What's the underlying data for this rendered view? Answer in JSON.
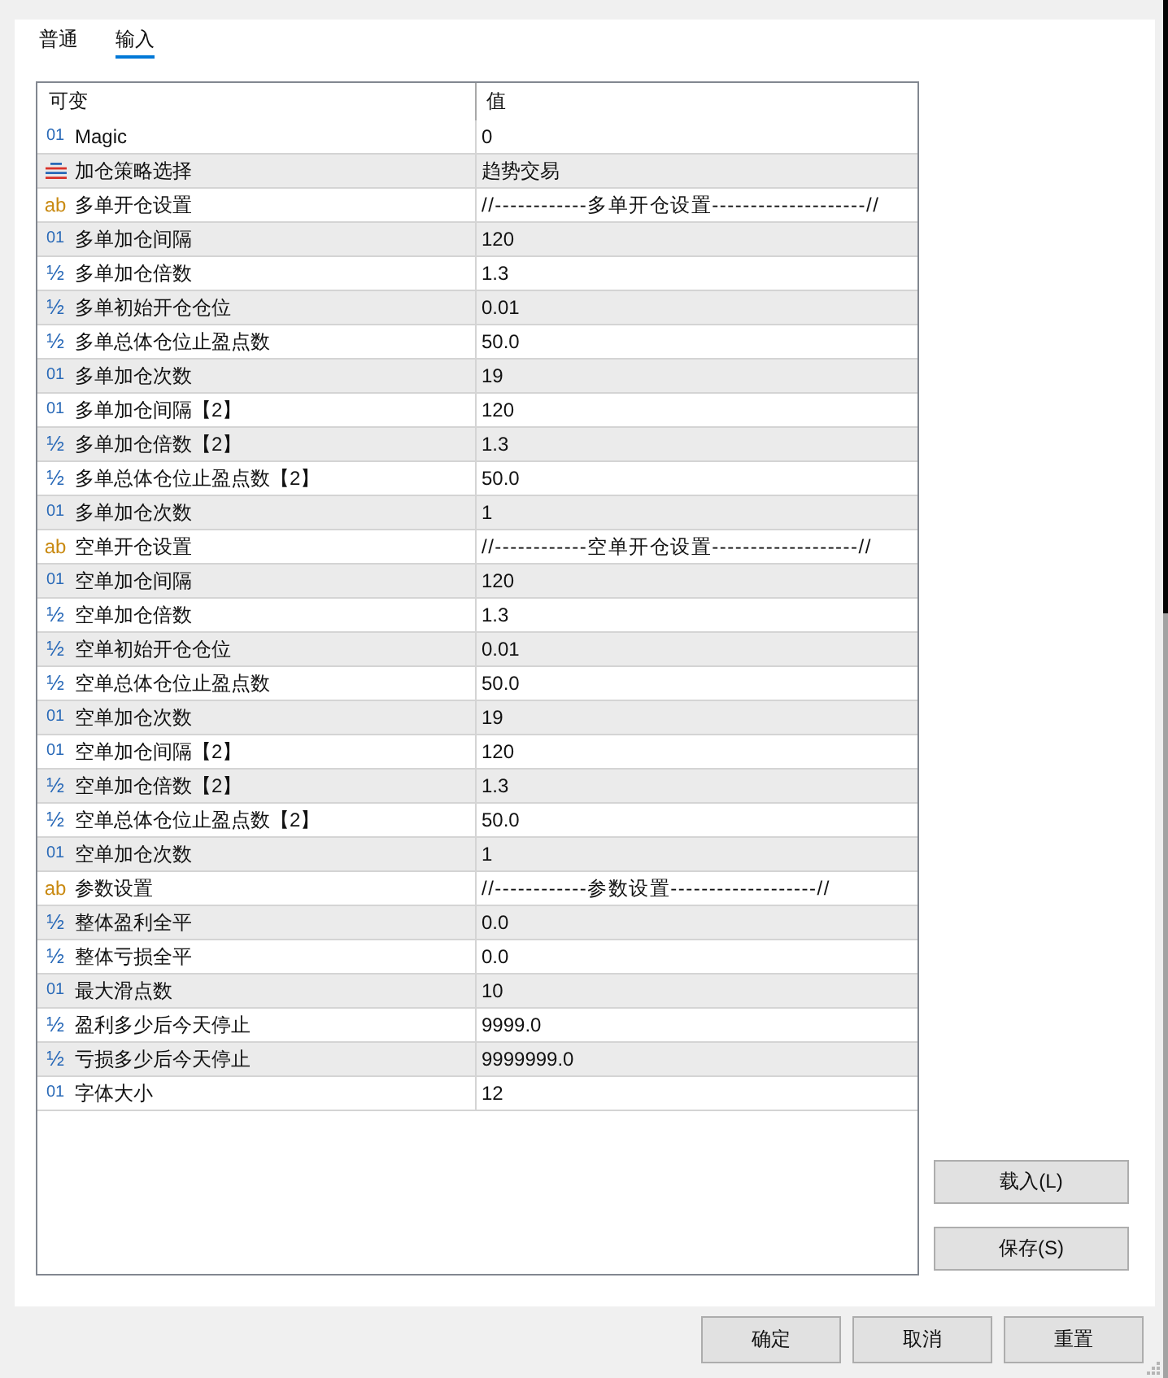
{
  "tabs": [
    {
      "label": "普通",
      "selected": false
    },
    {
      "label": "输入",
      "selected": true
    }
  ],
  "table": {
    "columns": [
      "可变",
      "值"
    ],
    "rows": [
      {
        "kind": "int",
        "icon": "01",
        "name": "Magic",
        "value": "0"
      },
      {
        "kind": "enum",
        "name": "加仓策略选择",
        "value": "趋势交易"
      },
      {
        "kind": "string",
        "icon": "ab",
        "name": "多单开仓设置",
        "value": "//------------多单开仓设置--------------------//"
      },
      {
        "kind": "int",
        "icon": "01",
        "name": "多单加仓间隔",
        "value": "120"
      },
      {
        "kind": "double",
        "icon": "½",
        "name": "多单加仓倍数",
        "value": "1.3"
      },
      {
        "kind": "double",
        "icon": "½",
        "name": "多单初始开仓仓位",
        "value": "0.01"
      },
      {
        "kind": "double",
        "icon": "½",
        "name": "多单总体仓位止盈点数",
        "value": "50.0"
      },
      {
        "kind": "int",
        "icon": "01",
        "name": "多单加仓次数",
        "value": "19"
      },
      {
        "kind": "int",
        "icon": "01",
        "name": "多单加仓间隔【2】",
        "value": "120"
      },
      {
        "kind": "double",
        "icon": "½",
        "name": "多单加仓倍数【2】",
        "value": "1.3"
      },
      {
        "kind": "double",
        "icon": "½",
        "name": "多单总体仓位止盈点数【2】",
        "value": "50.0"
      },
      {
        "kind": "int",
        "icon": "01",
        "name": "多单加仓次数",
        "value": "1"
      },
      {
        "kind": "string",
        "icon": "ab",
        "name": "空单开仓设置",
        "value": "//------------空单开仓设置-------------------//"
      },
      {
        "kind": "int",
        "icon": "01",
        "name": "空单加仓间隔",
        "value": "120"
      },
      {
        "kind": "double",
        "icon": "½",
        "name": "空单加仓倍数",
        "value": "1.3"
      },
      {
        "kind": "double",
        "icon": "½",
        "name": "空单初始开仓仓位",
        "value": "0.01"
      },
      {
        "kind": "double",
        "icon": "½",
        "name": "空单总体仓位止盈点数",
        "value": "50.0"
      },
      {
        "kind": "int",
        "icon": "01",
        "name": "空单加仓次数",
        "value": "19"
      },
      {
        "kind": "int",
        "icon": "01",
        "name": "空单加仓间隔【2】",
        "value": "120"
      },
      {
        "kind": "double",
        "icon": "½",
        "name": "空单加仓倍数【2】",
        "value": "1.3"
      },
      {
        "kind": "double",
        "icon": "½",
        "name": "空单总体仓位止盈点数【2】",
        "value": "50.0"
      },
      {
        "kind": "int",
        "icon": "01",
        "name": "空单加仓次数",
        "value": "1"
      },
      {
        "kind": "string",
        "icon": "ab",
        "name": "参数设置",
        "value": "//------------参数设置-------------------//"
      },
      {
        "kind": "double",
        "icon": "½",
        "name": "整体盈利全平",
        "value": "0.0"
      },
      {
        "kind": "double",
        "icon": "½",
        "name": "整体亏损全平",
        "value": "0.0"
      },
      {
        "kind": "int",
        "icon": "01",
        "name": "最大滑点数",
        "value": "10"
      },
      {
        "kind": "double",
        "icon": "½",
        "name": "盈利多少后今天停止",
        "value": "9999.0"
      },
      {
        "kind": "double",
        "icon": "½",
        "name": "亏损多少后今天停止",
        "value": "9999999.0"
      },
      {
        "kind": "int",
        "icon": "01",
        "name": "字体大小",
        "value": "12"
      }
    ]
  },
  "side_buttons": [
    "载入(L)",
    "保存(S)"
  ],
  "footer_buttons": [
    "确定",
    "取消",
    "重置"
  ]
}
